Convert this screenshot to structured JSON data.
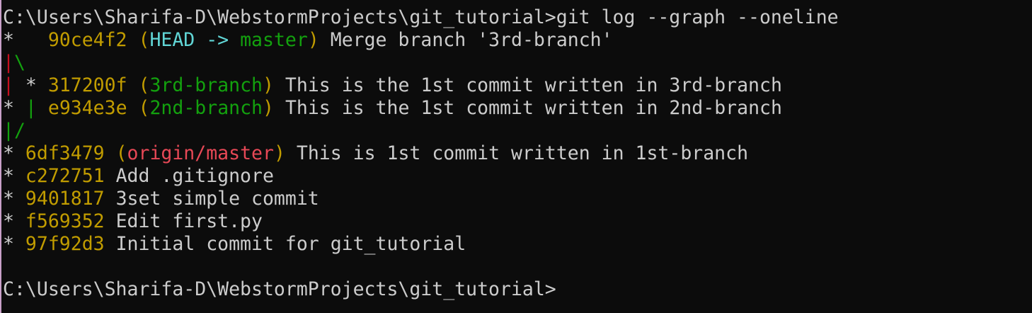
{
  "terminal": {
    "lines": [
      [
        {
          "text": "C:\\Users\\Sharifa-D\\WebstormProjects\\git_tutorial>git log --graph --oneline",
          "color": "default"
        }
      ],
      [
        {
          "text": "*   ",
          "color": "default"
        },
        {
          "text": "90ce4f2",
          "color": "yellow"
        },
        {
          "text": " (",
          "color": "yellow"
        },
        {
          "text": "HEAD -> ",
          "color": "cyanb"
        },
        {
          "text": "master",
          "color": "green"
        },
        {
          "text": ")",
          "color": "yellow"
        },
        {
          "text": " Merge branch '3rd-branch'",
          "color": "default"
        }
      ],
      [
        {
          "text": "|",
          "color": "red"
        },
        {
          "text": "\\",
          "color": "green"
        }
      ],
      [
        {
          "text": "|",
          "color": "red"
        },
        {
          "text": " * ",
          "color": "default"
        },
        {
          "text": "317200f",
          "color": "yellow"
        },
        {
          "text": " (",
          "color": "yellow"
        },
        {
          "text": "3rd-branch",
          "color": "green"
        },
        {
          "text": ")",
          "color": "yellow"
        },
        {
          "text": " This is the 1st commit written in 3rd-branch",
          "color": "default"
        }
      ],
      [
        {
          "text": "* ",
          "color": "default"
        },
        {
          "text": "|",
          "color": "green"
        },
        {
          "text": " ",
          "color": "default"
        },
        {
          "text": "e934e3e",
          "color": "yellow"
        },
        {
          "text": " (",
          "color": "yellow"
        },
        {
          "text": "2nd-branch",
          "color": "green"
        },
        {
          "text": ")",
          "color": "yellow"
        },
        {
          "text": " This is the 1st commit written in 2nd-branch",
          "color": "default"
        }
      ],
      [
        {
          "text": "|/",
          "color": "green"
        }
      ],
      [
        {
          "text": "* ",
          "color": "default"
        },
        {
          "text": "6df3479",
          "color": "yellow"
        },
        {
          "text": " (",
          "color": "yellow"
        },
        {
          "text": "origin/master",
          "color": "redb"
        },
        {
          "text": ")",
          "color": "yellow"
        },
        {
          "text": " This is 1st commit written in 1st-branch",
          "color": "default"
        }
      ],
      [
        {
          "text": "* ",
          "color": "default"
        },
        {
          "text": "c272751",
          "color": "yellow"
        },
        {
          "text": " Add .gitignore",
          "color": "default"
        }
      ],
      [
        {
          "text": "* ",
          "color": "default"
        },
        {
          "text": "9401817",
          "color": "yellow"
        },
        {
          "text": " 3set simple commit",
          "color": "default"
        }
      ],
      [
        {
          "text": "* ",
          "color": "default"
        },
        {
          "text": "f569352",
          "color": "yellow"
        },
        {
          "text": " Edit first.py",
          "color": "default"
        }
      ],
      [
        {
          "text": "* ",
          "color": "default"
        },
        {
          "text": "97f92d3",
          "color": "yellow"
        },
        {
          "text": " Initial commit for git_tutorial",
          "color": "default"
        }
      ],
      [],
      [
        {
          "text": "C:\\Users\\Sharifa-D\\WebstormProjects\\git_tutorial>",
          "color": "default"
        }
      ]
    ]
  },
  "colors": {
    "background": "#0c0c0c",
    "default": "#cccccc",
    "yellow": "#c19c00",
    "cyanb": "#61d6d6",
    "green": "#13a10e",
    "red": "#c50f1f",
    "redb": "#e74856"
  }
}
